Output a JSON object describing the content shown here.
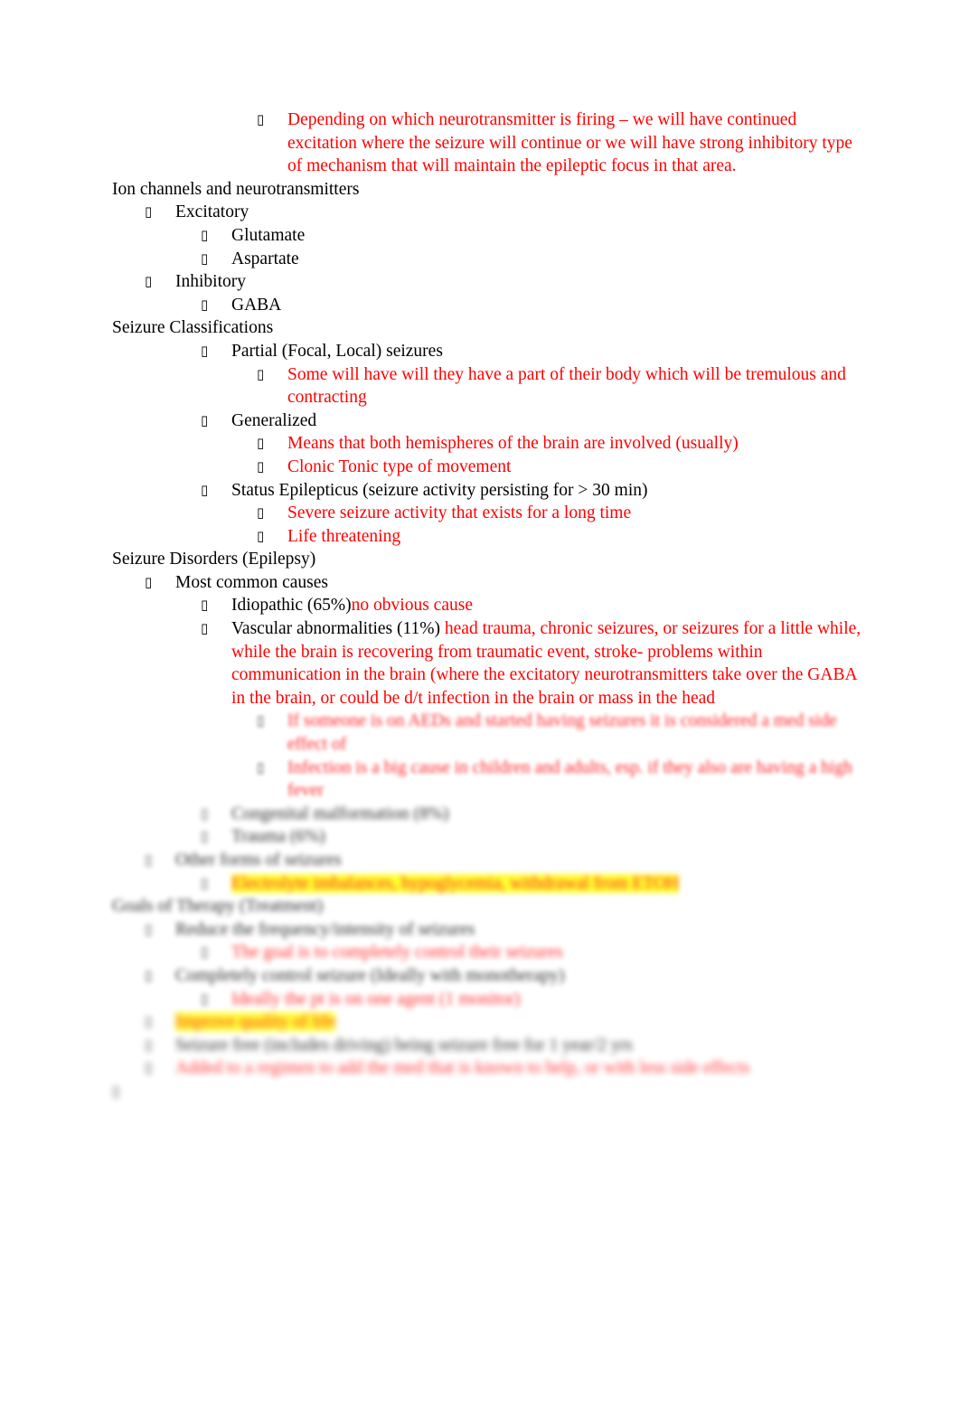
{
  "document": {
    "bullet_glyph": "▯",
    "blocks": [
      {
        "id": "b1",
        "level": 3,
        "bullet": true,
        "color": "red",
        "blur": 0,
        "highlight": false,
        "text": "Depending on which neurotransmitter is firing – we will have continued excitation where the seizure will continue or we will have strong inhibitory type of mechanism that will maintain the epileptic focus in that area."
      },
      {
        "id": "b2",
        "level": 0,
        "bullet": false,
        "color": "black",
        "blur": 0,
        "highlight": false,
        "text": "Ion channels and neurotransmitters"
      },
      {
        "id": "b3",
        "level": 1,
        "bullet": true,
        "color": "black",
        "blur": 0,
        "highlight": false,
        "text": "Excitatory"
      },
      {
        "id": "b4",
        "level": 2,
        "bullet": true,
        "color": "black",
        "blur": 0,
        "highlight": false,
        "text": "Glutamate"
      },
      {
        "id": "b5",
        "level": 2,
        "bullet": true,
        "color": "black",
        "blur": 0,
        "highlight": false,
        "text": "Aspartate"
      },
      {
        "id": "b6",
        "level": 1,
        "bullet": true,
        "color": "black",
        "blur": 0,
        "highlight": false,
        "text": "Inhibitory"
      },
      {
        "id": "b7",
        "level": 2,
        "bullet": true,
        "color": "black",
        "blur": 0,
        "highlight": false,
        "text": "GABA"
      },
      {
        "id": "b8",
        "level": 0,
        "bullet": false,
        "color": "black",
        "blur": 0,
        "highlight": false,
        "text": "Seizure Classifications"
      },
      {
        "id": "b9",
        "level": 2,
        "bullet": true,
        "color": "black",
        "blur": 0,
        "highlight": false,
        "text": "Partial (Focal, Local) seizures"
      },
      {
        "id": "b10",
        "level": 3,
        "bullet": true,
        "color": "red",
        "blur": 0,
        "highlight": false,
        "text": "Some will have will they have a part of their body which will be tremulous and contracting"
      },
      {
        "id": "b11",
        "level": 2,
        "bullet": true,
        "color": "black",
        "blur": 0,
        "highlight": false,
        "text": "Generalized"
      },
      {
        "id": "b12",
        "level": 3,
        "bullet": true,
        "color": "red",
        "blur": 0,
        "highlight": false,
        "text": "Means that both hemispheres of the brain are involved (usually)"
      },
      {
        "id": "b13",
        "level": 3,
        "bullet": true,
        "color": "red",
        "blur": 0,
        "highlight": false,
        "text": "Clonic Tonic type of movement"
      },
      {
        "id": "b14",
        "level": 2,
        "bullet": true,
        "color": "black",
        "blur": 0,
        "highlight": false,
        "text": "Status Epilepticus (seizure activity persisting for > 30 min)"
      },
      {
        "id": "b15",
        "level": 3,
        "bullet": true,
        "color": "red",
        "blur": 0,
        "highlight": false,
        "text": "Severe seizure activity that exists for a long time"
      },
      {
        "id": "b16",
        "level": 3,
        "bullet": true,
        "color": "red",
        "blur": 0,
        "highlight": false,
        "text": "Life threatening"
      },
      {
        "id": "b17",
        "level": 0,
        "bullet": false,
        "color": "black",
        "blur": 0,
        "highlight": false,
        "text": "Seizure Disorders (Epilepsy)"
      },
      {
        "id": "b18",
        "level": 1,
        "bullet": true,
        "color": "black",
        "blur": 0,
        "highlight": false,
        "text": "Most common causes"
      },
      {
        "id": "b19",
        "level": 2,
        "bullet": true,
        "color": "mixed",
        "blur": 0,
        "highlight": false,
        "black_part": "Idiopathic (65%)",
        "red_part": "no obvious cause"
      },
      {
        "id": "b20",
        "level": 2,
        "bullet": true,
        "color": "mixed",
        "blur": 0,
        "highlight": false,
        "black_part": "Vascular abnormalities (11%) ",
        "red_part": "head trauma, chronic seizures, or seizures for a little while, while the brain is recovering from traumatic event, stroke- problems within communication in the brain (where the excitatory neurotransmitters take over the GABA in the brain, or could be d/t infection in the brain or mass in the head"
      },
      {
        "id": "b21",
        "level": 3,
        "bullet": true,
        "color": "red",
        "blur": 3,
        "highlight": false,
        "text": "If someone is on AEDs and started having seizures it is considered a med side effect of"
      },
      {
        "id": "b22",
        "level": 3,
        "bullet": true,
        "color": "red",
        "blur": 3,
        "highlight": false,
        "text": "Infection is a big cause in children and adults, esp. if they also are having a high fever"
      },
      {
        "id": "b23",
        "level": 2,
        "bullet": true,
        "color": "black",
        "blur": 4,
        "highlight": false,
        "text": "Congenital malformation (8%)"
      },
      {
        "id": "b24",
        "level": 2,
        "bullet": true,
        "color": "black",
        "blur": 4,
        "highlight": false,
        "text": "Trauma (6%)"
      },
      {
        "id": "b25",
        "level": 1,
        "bullet": true,
        "color": "black",
        "blur": 4,
        "highlight": false,
        "text": "Other forms of seizures"
      },
      {
        "id": "b26",
        "level": 2,
        "bullet": true,
        "color": "red",
        "blur": 4,
        "highlight": true,
        "text": "Electrolyte imbalances, hypoglycemia, withdrawal from ETOH"
      },
      {
        "id": "b27",
        "level": 0,
        "bullet": false,
        "color": "black",
        "blur": 4,
        "highlight": false,
        "text": "Goals of Therapy (Treatment)"
      },
      {
        "id": "b28",
        "level": 1,
        "bullet": true,
        "color": "black",
        "blur": 4,
        "highlight": false,
        "text": "Reduce the frequency/intensity of seizures"
      },
      {
        "id": "b29",
        "level": 2,
        "bullet": true,
        "color": "red",
        "blur": 4,
        "highlight": false,
        "text": "The goal is to completely control their seizures"
      },
      {
        "id": "b30",
        "level": 1,
        "bullet": true,
        "color": "black",
        "blur": 4,
        "highlight": false,
        "text": "Completely control seizure (Ideally with monotherapy)"
      },
      {
        "id": "b31",
        "level": 2,
        "bullet": true,
        "color": "red",
        "blur": 4,
        "highlight": false,
        "text": "Ideally the pt is on one agent (1 monitor)"
      },
      {
        "id": "b32",
        "level": 1,
        "bullet": true,
        "color": "red",
        "blur": 5,
        "highlight": true,
        "text": "Improve quality of life"
      },
      {
        "id": "b33",
        "level": 1,
        "bullet": true,
        "color": "black",
        "blur": 5,
        "highlight": false,
        "text": "Seizure free (includes driving) being seizure free for 1 year/2 yrs"
      },
      {
        "id": "b34",
        "level": 1,
        "bullet": true,
        "color": "red",
        "blur": 5,
        "highlight": false,
        "text": "Added to a regimen to add the med that is known to help, or with less side effects"
      },
      {
        "id": "b35",
        "level": 0,
        "bullet": true,
        "color": "black",
        "blur": 5,
        "highlight": false,
        "text": ""
      }
    ]
  }
}
